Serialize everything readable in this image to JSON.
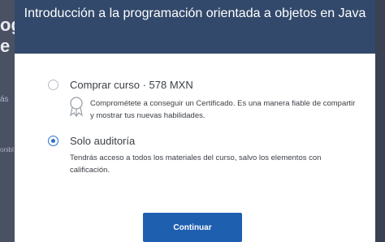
{
  "background": {
    "title_fragment": "og",
    "title_fragment2": "e",
    "link_fragment": "ás",
    "small_fragment": "onibl"
  },
  "modal": {
    "title": "Introducción a la programación orientada a objetos en Java",
    "options": [
      {
        "label": "Comprar curso · 578 MXN",
        "description": "Comprométete a conseguir un Certificado. Es una manera fiable de compartir y mostrar tus nuevas habilidades.",
        "selected": false,
        "icon": "certificate-icon"
      },
      {
        "label": "Solo auditoría",
        "description": "Tendrás acceso a todos los materiales del curso, salvo los elementos con calificación.",
        "selected": true
      }
    ],
    "continue_label": "Continuar"
  },
  "colors": {
    "header_bg": "#32496b",
    "button_bg": "#1f5fb0",
    "radio_selected": "#2a73c9"
  }
}
